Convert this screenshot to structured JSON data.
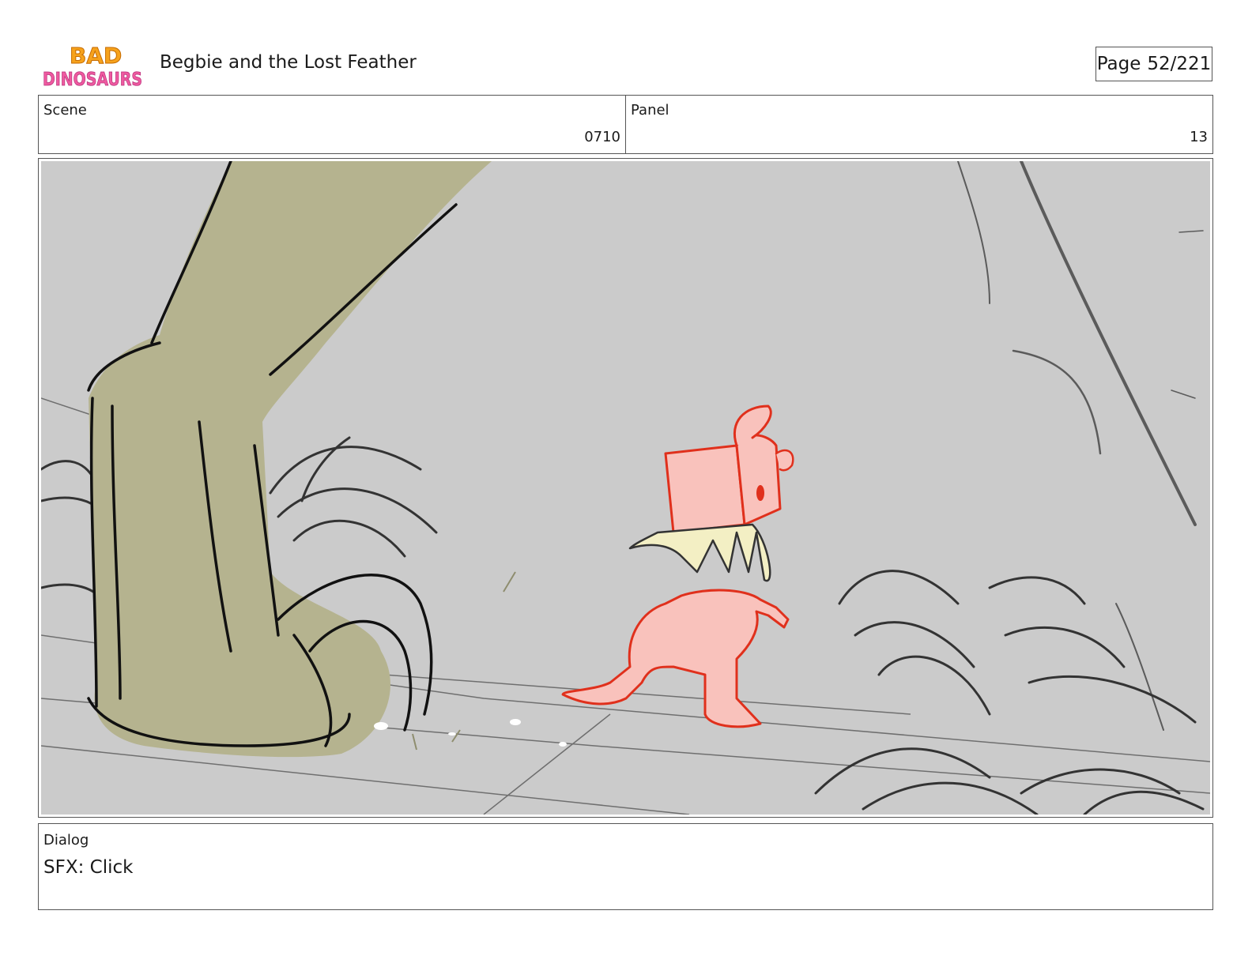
{
  "header": {
    "logo": {
      "line1": "BAD",
      "line2": "DINOSAURS"
    },
    "title": "Begbie and the Lost Feather",
    "page_label": "Page",
    "page_value": "52/221"
  },
  "scene": {
    "label": "Scene",
    "value": "0710"
  },
  "panel": {
    "label": "Panel",
    "value": "13"
  },
  "dialog": {
    "label": "Dialog",
    "text": "SFX: Click"
  },
  "colors": {
    "background_gray": "#cbcbcb",
    "dino_leg": "#b5b38f",
    "pink_dino_fill": "#f9c2bc",
    "pink_dino_line": "#e0301c",
    "teeth": "#f3efc4"
  }
}
